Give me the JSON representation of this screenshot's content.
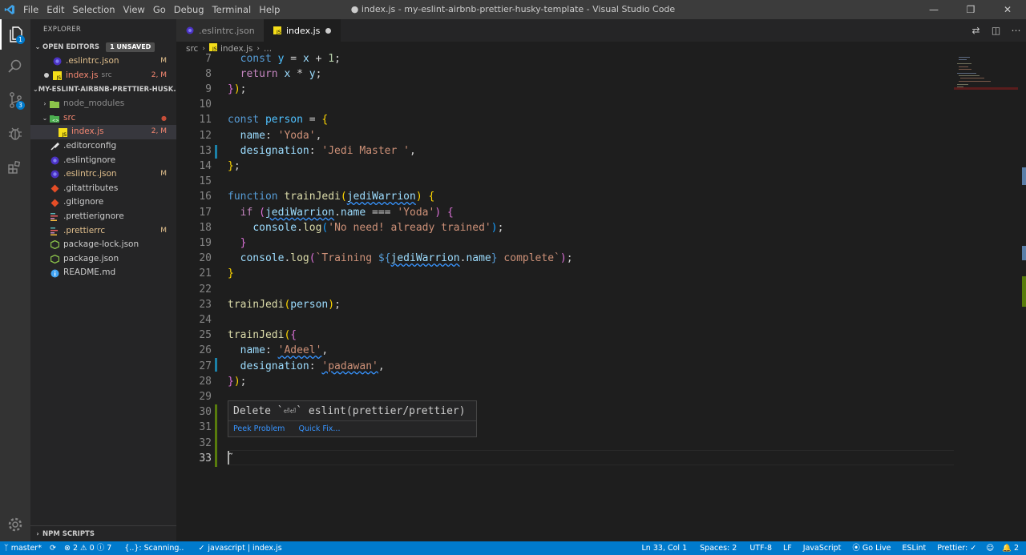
{
  "window": {
    "title": "● index.js - my-eslint-airbnb-prettier-husky-template - Visual Studio Code",
    "menu": [
      "File",
      "Edit",
      "Selection",
      "View",
      "Go",
      "Debug",
      "Terminal",
      "Help"
    ]
  },
  "activity_bar": {
    "items": [
      {
        "name": "explorer-icon",
        "badge": "1"
      },
      {
        "name": "search-icon",
        "badge": ""
      },
      {
        "name": "source-control-icon",
        "badge": "3"
      },
      {
        "name": "debug-icon",
        "badge": ""
      },
      {
        "name": "extensions-icon",
        "badge": ""
      }
    ]
  },
  "sidebar": {
    "title": "EXPLORER",
    "open_editors": {
      "header": "OPEN EDITORS",
      "badge": "1 UNSAVED",
      "items": [
        {
          "label": "eslintrc.json",
          "prefix": ".",
          "icon": "eslint",
          "path": "",
          "deco": "M",
          "status": "modified",
          "dirty": false
        },
        {
          "label": "index.js",
          "prefix": "",
          "icon": "js",
          "path": "src",
          "deco": "2, M",
          "status": "error",
          "dirty": true
        }
      ]
    },
    "folder": {
      "header": "MY-ESLINT-AIRBNB-PRETTIER-HUSK...",
      "items": [
        {
          "label": "node_modules",
          "icon": "folder-node",
          "indent": 1,
          "twistie": "›",
          "deco": "",
          "status": "dim"
        },
        {
          "label": "src",
          "icon": "folder-src",
          "indent": 1,
          "twistie": "⌄",
          "deco": "●",
          "status": "error"
        },
        {
          "label": "index.js",
          "icon": "js",
          "indent": 2,
          "twistie": "",
          "deco": "2, M",
          "status": "error"
        },
        {
          "label": ".editorconfig",
          "icon": "editorconfig",
          "indent": 1,
          "twistie": "",
          "deco": "",
          "status": ""
        },
        {
          "label": ".eslintignore",
          "icon": "eslint",
          "indent": 1,
          "twistie": "",
          "deco": "",
          "status": ""
        },
        {
          "label": ".eslintrc.json",
          "icon": "eslint",
          "indent": 1,
          "twistie": "",
          "deco": "M",
          "status": "modified"
        },
        {
          "label": ".gitattributes",
          "icon": "git",
          "indent": 1,
          "twistie": "",
          "deco": "",
          "status": ""
        },
        {
          "label": ".gitignore",
          "icon": "git",
          "indent": 1,
          "twistie": "",
          "deco": "",
          "status": ""
        },
        {
          "label": ".prettierignore",
          "icon": "prettier",
          "indent": 1,
          "twistie": "",
          "deco": "",
          "status": ""
        },
        {
          "label": ".prettierrc",
          "icon": "prettier",
          "indent": 1,
          "twistie": "",
          "deco": "M",
          "status": "modified"
        },
        {
          "label": "package-lock.json",
          "icon": "npm",
          "indent": 1,
          "twistie": "",
          "deco": "",
          "status": ""
        },
        {
          "label": "package.json",
          "icon": "npm",
          "indent": 1,
          "twistie": "",
          "deco": "",
          "status": ""
        },
        {
          "label": "README.md",
          "icon": "info",
          "indent": 1,
          "twistie": "",
          "deco": "",
          "status": ""
        }
      ]
    },
    "npm_scripts": "NPM SCRIPTS"
  },
  "tabs": [
    {
      "label": ".eslintrc.json",
      "active": false
    },
    {
      "label": "index.js",
      "active": true,
      "dirty": true
    }
  ],
  "breadcrumbs": [
    "src",
    "index.js",
    "..."
  ],
  "code": [
    {
      "n": "7",
      "t": [
        [
          "  ",
          ""
        ],
        [
          "const",
          "kw"
        ],
        [
          " ",
          ""
        ],
        [
          "y",
          "cst"
        ],
        [
          " = ",
          "pun"
        ],
        [
          "x",
          "var"
        ],
        [
          " + ",
          "pun"
        ],
        [
          "1",
          "num"
        ],
        [
          ";",
          "pun"
        ]
      ]
    },
    {
      "n": "8",
      "t": [
        [
          "  ",
          ""
        ],
        [
          "return",
          "ctl"
        ],
        [
          " ",
          ""
        ],
        [
          "x",
          "var"
        ],
        [
          " * ",
          "pun"
        ],
        [
          "y",
          "var"
        ],
        [
          ";",
          "pun"
        ]
      ]
    },
    {
      "n": "9",
      "t": [
        [
          "}",
          "br2"
        ],
        [
          ")",
          "br1"
        ],
        [
          ";",
          "pun"
        ]
      ]
    },
    {
      "n": "10",
      "t": []
    },
    {
      "n": "11",
      "t": [
        [
          "const",
          "kw"
        ],
        [
          " ",
          ""
        ],
        [
          "person",
          "cst"
        ],
        [
          " = ",
          "pun"
        ],
        [
          "{",
          "br1"
        ]
      ]
    },
    {
      "n": "12",
      "t": [
        [
          "  ",
          ""
        ],
        [
          "name",
          "var"
        ],
        [
          ": ",
          "pun"
        ],
        [
          "'Yoda'",
          "str"
        ],
        [
          ",",
          "pun"
        ]
      ]
    },
    {
      "n": "13",
      "t": [
        [
          "  ",
          ""
        ],
        [
          "designation",
          "var"
        ],
        [
          ": ",
          "pun"
        ],
        [
          "'Jedi Master '",
          "str"
        ],
        [
          ",",
          "pun"
        ]
      ]
    },
    {
      "n": "14",
      "t": [
        [
          "}",
          "br1"
        ],
        [
          ";",
          "pun"
        ]
      ]
    },
    {
      "n": "15",
      "t": []
    },
    {
      "n": "16",
      "t": [
        [
          "function",
          "kw"
        ],
        [
          " ",
          ""
        ],
        [
          "trainJedi",
          "fn"
        ],
        [
          "(",
          "br1"
        ],
        [
          "jediWarrion",
          "var sq"
        ],
        [
          ")",
          "br1"
        ],
        [
          " ",
          ""
        ],
        [
          "{",
          "br1"
        ]
      ]
    },
    {
      "n": "17",
      "t": [
        [
          "  ",
          ""
        ],
        [
          "if",
          "ctl"
        ],
        [
          " ",
          ""
        ],
        [
          "(",
          "br2"
        ],
        [
          "jediWarrion",
          "var sq"
        ],
        [
          ".",
          "pun"
        ],
        [
          "name",
          "var"
        ],
        [
          " === ",
          "pun"
        ],
        [
          "'Yoda'",
          "str"
        ],
        [
          ")",
          "br2"
        ],
        [
          " ",
          ""
        ],
        [
          "{",
          "br2"
        ]
      ]
    },
    {
      "n": "18",
      "t": [
        [
          "    ",
          ""
        ],
        [
          "console",
          "var"
        ],
        [
          ".",
          "pun"
        ],
        [
          "log",
          "fn"
        ],
        [
          "(",
          "br3"
        ],
        [
          "'No need! already trained'",
          "str"
        ],
        [
          ")",
          "br3"
        ],
        [
          ";",
          "pun"
        ]
      ]
    },
    {
      "n": "19",
      "t": [
        [
          "  ",
          ""
        ],
        [
          "}",
          "br2"
        ]
      ]
    },
    {
      "n": "20",
      "t": [
        [
          "  ",
          ""
        ],
        [
          "console",
          "var"
        ],
        [
          ".",
          "pun"
        ],
        [
          "log",
          "fn"
        ],
        [
          "(",
          "br2"
        ],
        [
          "`Training ",
          "str"
        ],
        [
          "${",
          "kw"
        ],
        [
          "jediWarrion",
          "var sq"
        ],
        [
          ".",
          "pun"
        ],
        [
          "name",
          "var"
        ],
        [
          "}",
          "kw"
        ],
        [
          " complete`",
          "str"
        ],
        [
          ")",
          "br2"
        ],
        [
          ";",
          "pun"
        ]
      ]
    },
    {
      "n": "21",
      "t": [
        [
          "}",
          "br1"
        ]
      ]
    },
    {
      "n": "22",
      "t": []
    },
    {
      "n": "23",
      "t": [
        [
          "trainJedi",
          "fn"
        ],
        [
          "(",
          "br1"
        ],
        [
          "person",
          "var"
        ],
        [
          ")",
          "br1"
        ],
        [
          ";",
          "pun"
        ]
      ]
    },
    {
      "n": "24",
      "t": []
    },
    {
      "n": "25",
      "t": [
        [
          "trainJedi",
          "fn"
        ],
        [
          "(",
          "br1"
        ],
        [
          "{",
          "br2"
        ]
      ]
    },
    {
      "n": "26",
      "t": [
        [
          "  ",
          ""
        ],
        [
          "name",
          "var"
        ],
        [
          ": ",
          "pun"
        ],
        [
          "'Adeel'",
          "str sq"
        ],
        [
          ",",
          "pun"
        ]
      ]
    },
    {
      "n": "27",
      "t": [
        [
          "  ",
          ""
        ],
        [
          "designation",
          "var"
        ],
        [
          ": ",
          "pun"
        ],
        [
          "'padawan'",
          "str sq"
        ],
        [
          ",",
          "pun"
        ]
      ]
    },
    {
      "n": "28",
      "t": [
        [
          "}",
          "br2"
        ],
        [
          ")",
          "br1"
        ],
        [
          ";",
          "pun"
        ]
      ]
    },
    {
      "n": "29",
      "t": []
    },
    {
      "n": "30",
      "t": []
    },
    {
      "n": "31",
      "t": []
    },
    {
      "n": "32",
      "t": []
    },
    {
      "n": "33",
      "t": [
        [
          "˜",
          "pun"
        ]
      ]
    }
  ],
  "hover": {
    "message": "Delete `⏎⏎` eslint(prettier/prettier)",
    "peek": "Peek Problem",
    "quickfix": "Quick Fix..."
  },
  "status_bar": {
    "branch": "master*",
    "errors": "2",
    "warnings": "0",
    "info": "7",
    "scanning": "{..}: Scanning..",
    "lang_check": "javascript | index.js",
    "position": "Ln 33, Col 1",
    "spaces": "Spaces: 2",
    "encoding": "UTF-8",
    "eol": "LF",
    "language": "JavaScript",
    "golive": "Go Live",
    "eslint": "ESLint",
    "prettier": "Prettier: ✓",
    "notifications": "2"
  },
  "colors": {
    "accent": "#007acc",
    "modified": "#e2c08d",
    "error": "#f48771"
  }
}
